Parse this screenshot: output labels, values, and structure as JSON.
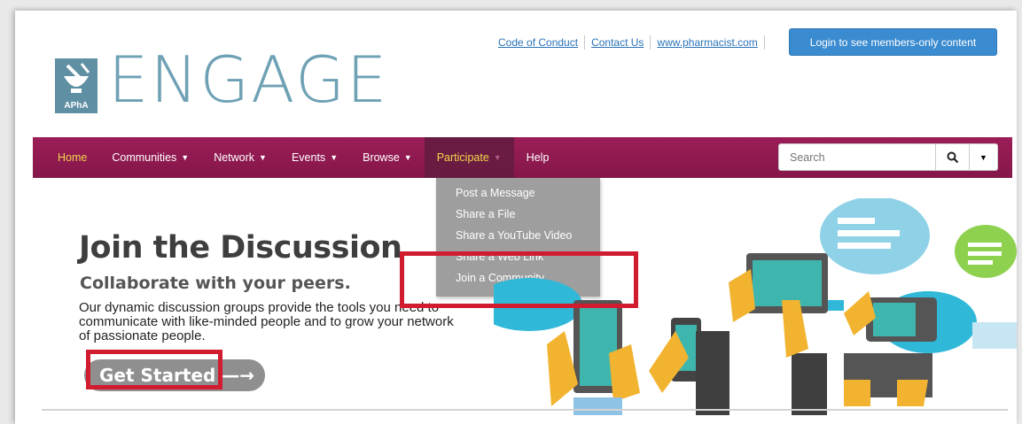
{
  "toplinks": {
    "code_of_conduct": "Code of Conduct",
    "contact_us": "Contact Us",
    "pharmacist": "www.pharmacist.com"
  },
  "login_button": "Login to see members-only content",
  "logo": {
    "word": "ENGAGE",
    "badge_text": "APhA"
  },
  "nav": {
    "home": "Home",
    "communities": "Communities",
    "network": "Network",
    "events": "Events",
    "browse": "Browse",
    "participate": "Participate",
    "help": "Help"
  },
  "search": {
    "placeholder": "Search"
  },
  "participate_menu": [
    "Post a Message",
    "Share a File",
    "Share a YouTube Video",
    "Share a Web Link",
    "Join a Community"
  ],
  "hero": {
    "title": "Join the Discussion",
    "subtitle": "Collaborate with your peers.",
    "body": "Our dynamic discussion groups provide the tools you need to communicate with like-minded people and to grow your network of passionate people.",
    "cta": "Get Started"
  },
  "colors": {
    "nav_bg": "#8e1a50",
    "nav_active": "#6a1b41",
    "nav_highlight_text": "#f3d54e",
    "login_btn": "#3b8bd0",
    "link": "#2a73b8",
    "logo": "#6fa1b5",
    "highlight_box": "#d11c30"
  }
}
